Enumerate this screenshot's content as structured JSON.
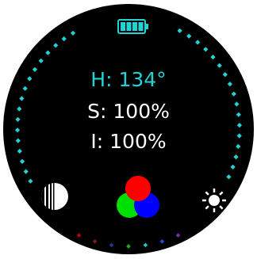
{
  "colors": {
    "background": "#000000",
    "accent": "#22d3d6",
    "text": "#ffffff",
    "battery": "#22d3d6"
  },
  "readouts": {
    "hue": "H: 134°",
    "saturation": "S: 100%",
    "intensity": "I: 100%"
  },
  "icons": {
    "battery": "battery-full-icon",
    "saturation": "half-circle-stripes-icon",
    "color_mode": "rgb-circles-icon",
    "brightness": "sun-icon"
  },
  "battery_level": 1.0,
  "bottom_dots": [
    "#c00000",
    "#7a1c1c",
    "#1f3a88",
    "#22aa22",
    "#22c2c8",
    "#1a4fd8",
    "#7a2ea8"
  ]
}
